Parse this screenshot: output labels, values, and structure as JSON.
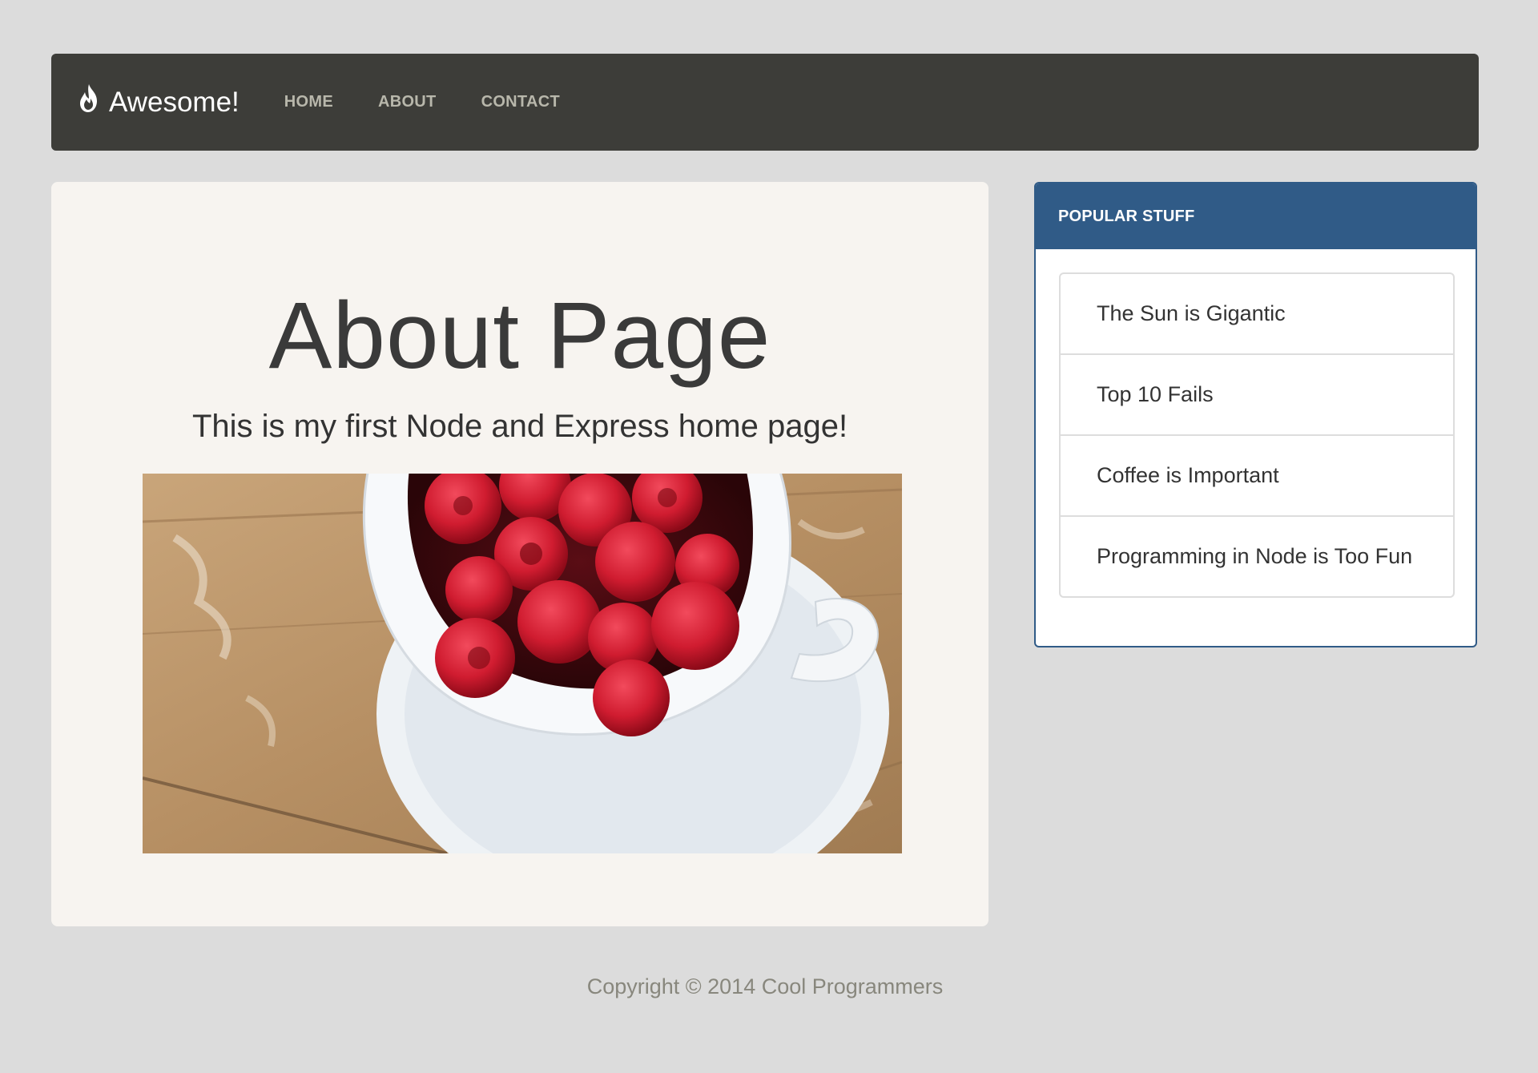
{
  "navbar": {
    "brand": "Awesome!",
    "brand_icon": "flame-icon",
    "links": [
      "HOME",
      "ABOUT",
      "CONTACT"
    ]
  },
  "main": {
    "title": "About Page",
    "subtitle": "This is my first Node and Express home page!"
  },
  "sidebar": {
    "header": "POPULAR STUFF",
    "items": [
      "The Sun is Gigantic",
      "Top 10 Fails",
      "Coffee is Important",
      "Programming in Node is Too Fun"
    ]
  },
  "footer": {
    "text": "Copyright © 2014 Cool Programmers"
  },
  "colors": {
    "page_background": "#dcdcdc",
    "navbar_background": "#3d3d39",
    "panel_background": "#f7f4f0",
    "sidebar_accent": "#305b87"
  }
}
